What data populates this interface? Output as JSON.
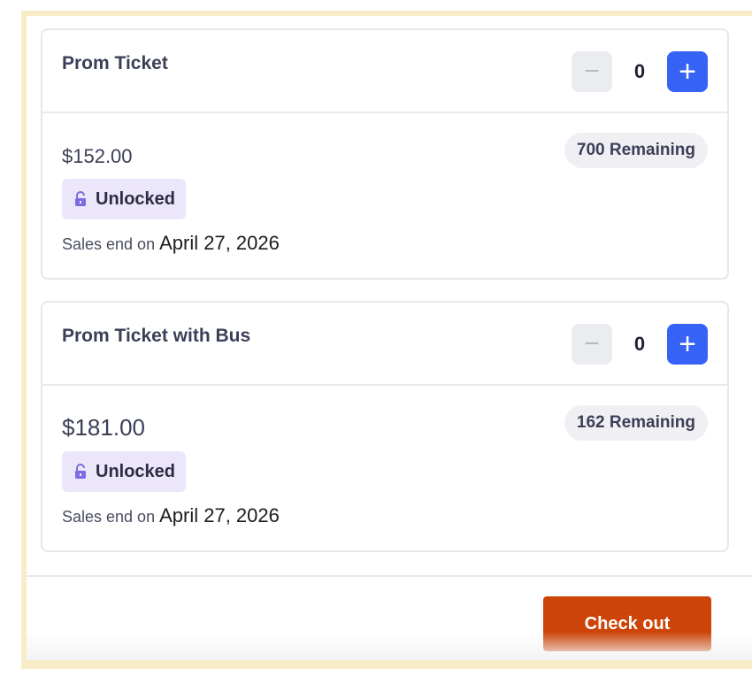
{
  "tickets": [
    {
      "title": "Prom Ticket",
      "quantity": "0",
      "minus_symbol": "−",
      "plus_symbol": "+",
      "price": "$152.00",
      "remaining": "700 Remaining",
      "badge": "Unlocked",
      "sales_prefix": "Sales end on ",
      "sales_date": "April 27, 2026"
    },
    {
      "title": "Prom Ticket with Bus",
      "quantity": "0",
      "minus_symbol": "−",
      "plus_symbol": "+",
      "price": "$181.00",
      "remaining": "162 Remaining",
      "badge": "Unlocked",
      "sales_prefix": "Sales end on ",
      "sales_date": "April 27, 2026"
    }
  ],
  "checkout": {
    "label": "Check out"
  },
  "colors": {
    "accent_blue": "#3762f6",
    "checkout_orange": "#cc4407",
    "badge_bg": "#ece6fb",
    "lock_icon": "#7d6ce0",
    "frame": "#f8ecc8"
  },
  "icons": {
    "badge_icon": "unlock-icon"
  }
}
